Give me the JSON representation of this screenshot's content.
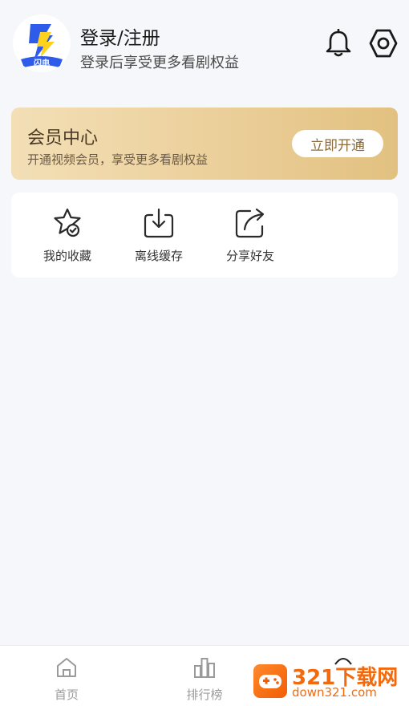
{
  "header": {
    "logo_text": "闪电",
    "title": "登录/注册",
    "subtitle": "登录后享受更多看剧权益"
  },
  "vip": {
    "title": "会员中心",
    "subtitle": "开通视频会员，享受更多看剧权益",
    "button_label": "立即开通"
  },
  "shortcuts": [
    {
      "label": "我的收藏",
      "icon": "star-check-icon"
    },
    {
      "label": "离线缓存",
      "icon": "download-icon"
    },
    {
      "label": "分享好友",
      "icon": "share-icon"
    }
  ],
  "tabbar": [
    {
      "label": "首页",
      "icon": "home-icon"
    },
    {
      "label": "排行榜",
      "icon": "ranking-icon"
    }
  ],
  "watermark": {
    "top": "321下载网",
    "bottom": "down321.com"
  },
  "colors": {
    "background": "#f6f7fa",
    "vip_gradient_start": "#f3dfb6",
    "vip_gradient_end": "#e2c180",
    "logo_blue": "#2f5bea",
    "logo_yellow": "#ffd21f",
    "watermark_orange": "#f26a0d"
  }
}
